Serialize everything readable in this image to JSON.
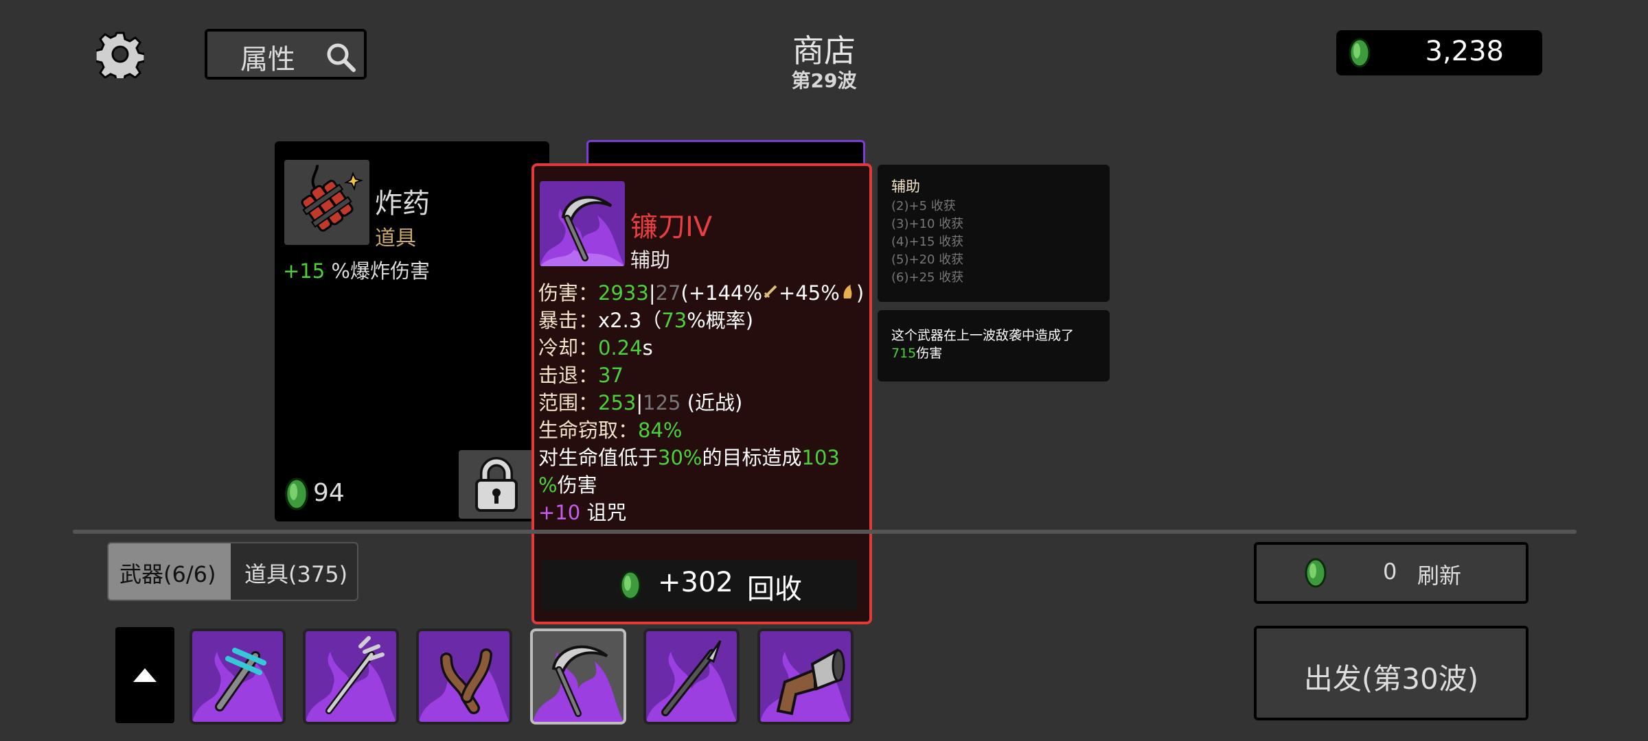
{
  "header": {
    "search_label": "属性",
    "title": "商店",
    "wave": "第29波",
    "materials": "3,238"
  },
  "shop_item": {
    "name": "炸药",
    "type": "道具",
    "effect_value": "+15",
    "effect_text": " %爆炸伤害",
    "price": "94"
  },
  "tooltip": {
    "name": "镰刀IV",
    "type": "辅助",
    "damage_label": "伤害：",
    "damage_value": "2933",
    "damage_sep": "|",
    "damage_base": "27",
    "damage_scaling": "(+144%",
    "damage_scaling2": "+45%",
    "damage_close": ")",
    "crit_label": "暴击：",
    "crit_mult": "x2.3（",
    "crit_chance": "73",
    "crit_suffix": "%概率)",
    "cooldown_label": "冷却：",
    "cooldown_value": "0.24",
    "cooldown_unit": "s",
    "knockback_label": "击退：",
    "knockback_value": "37",
    "range_label": "范围：",
    "range_value": "253",
    "range_sep": "|",
    "range_base": "125",
    "range_type": " (近战)",
    "lifesteal_label": "生命窃取：",
    "lifesteal_value": "84%",
    "special_pre": "对生命值低于",
    "special_threshold": "30%",
    "special_mid": "的目标造成",
    "special_dmg": "103",
    "special_pct": "%",
    "special_post": "伤害",
    "curse_value": "+10",
    "curse_label": " 诅咒",
    "recycle_amount": "+302",
    "recycle_label": "回收"
  },
  "set_bonus": {
    "title": "辅助",
    "rows": [
      "(2)+5 收获",
      "(3)+10 收获",
      "(4)+15 收获",
      "(5)+20 收获",
      "(6)+25 收获"
    ]
  },
  "last_wave": {
    "text_pre": "这个武器在上一波敌袭中造成了",
    "value": "715",
    "text_post": "伤害"
  },
  "tabs": {
    "weapons": "武器(6/6)",
    "items": "道具(375)"
  },
  "refresh": {
    "cost": "0",
    "label": "刷新"
  },
  "go_label": "出发(第30波)",
  "weapons": [
    "weapon-1",
    "weapon-2",
    "weapon-3",
    "weapon-4",
    "weapon-5",
    "weapon-6"
  ],
  "colors": {
    "background": "#333333",
    "tooltip_border": "#e03a3a",
    "tooltip_bg": "#250d0d",
    "green_stat": "#4cd137",
    "weapon_tier_purple": "#6b2aa8",
    "curse_purple": "#c95cf0"
  }
}
